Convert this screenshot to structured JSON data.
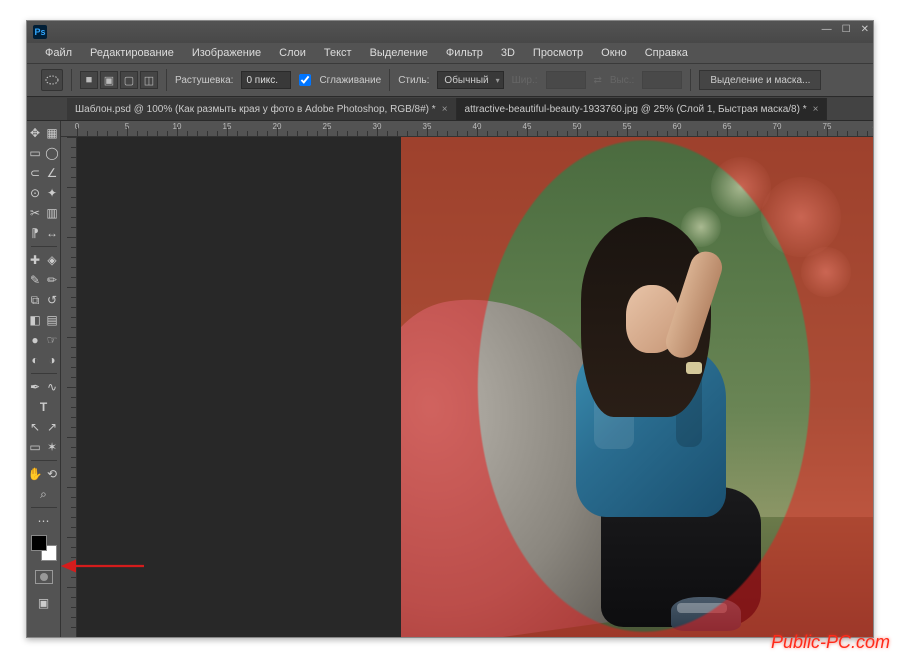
{
  "menubar": [
    "Файл",
    "Редактирование",
    "Изображение",
    "Слои",
    "Текст",
    "Выделение",
    "Фильтр",
    "3D",
    "Просмотр",
    "Окно",
    "Справка"
  ],
  "options": {
    "feather_label": "Растушевка:",
    "feather_value": "0 пикс.",
    "antialias": "Сглаживание",
    "style_label": "Стиль:",
    "style_value": "Обычный",
    "width_label": "Шир.:",
    "height_label": "Выс.:",
    "select_mask": "Выделение и маска..."
  },
  "tabs": [
    {
      "label": "Шаблон.psd @ 100% (Как размыть края у фото в Adobe Photoshop, RGB/8#) *",
      "active": false
    },
    {
      "label": "attractive-beautiful-beauty-1933760.jpg @ 25% (Слой 1, Быстрая маска/8) *",
      "active": true
    }
  ],
  "watermark": "Public-PC.com",
  "tools": {
    "move": "✥",
    "marquee-rect": "▭",
    "marquee-ellipse": "◯",
    "lasso": "⊂",
    "poly-lasso": "∠",
    "magic-wand": "✦",
    "quick-select": "⊙",
    "crop": "✂",
    "slice": "▥",
    "eyedropper": "⁋",
    "ruler": "↔",
    "healing": "✚",
    "brush": "✎",
    "clone": "⧉",
    "history": "↺",
    "eraser": "◧",
    "blur": "●",
    "gradient": "▤",
    "dodge": "◐",
    "smudge": "☞",
    "pen": "✒",
    "type": "T",
    "path": "↖",
    "shape": "▭",
    "hand": "✋",
    "zoom": "⌕",
    "more": "⋯"
  }
}
